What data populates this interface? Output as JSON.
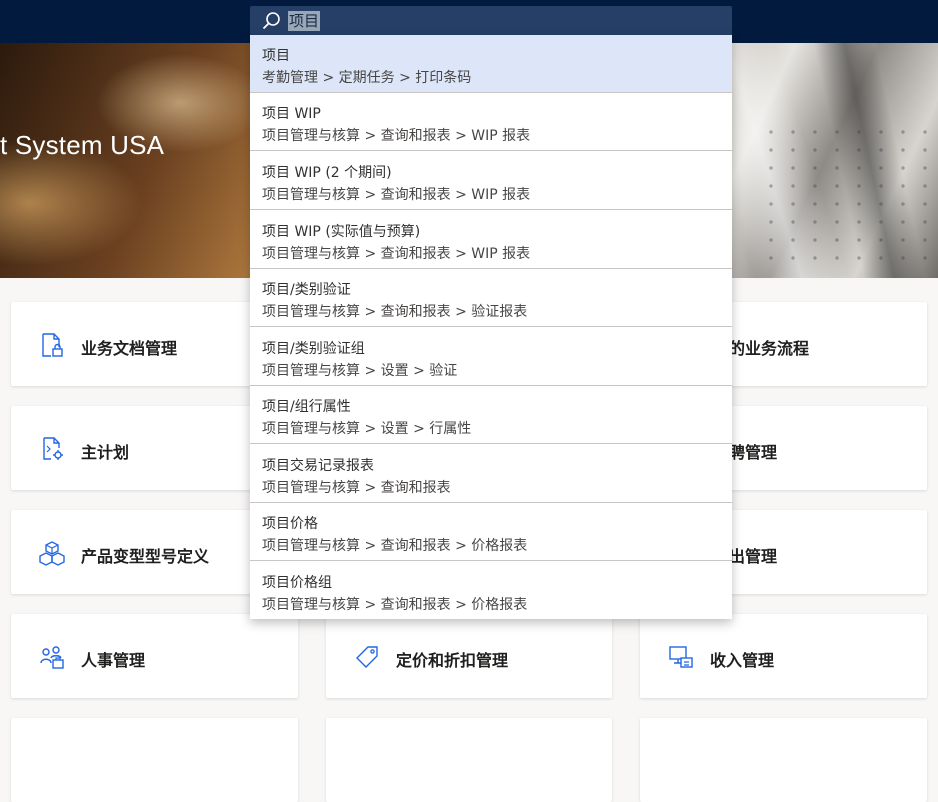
{
  "header": {
    "search": {
      "value": "项目",
      "placeholder": ""
    }
  },
  "hero": {
    "title": "t System USA"
  },
  "suggestions": [
    {
      "title": "项目",
      "path": "考勤管理 > 定期任务 > 打印条码"
    },
    {
      "title": "项目 WIP",
      "path": "项目管理与核算 > 查询和报表 > WIP 报表"
    },
    {
      "title": "项目 WIP (2 个期间)",
      "path": "项目管理与核算 > 查询和报表 > WIP 报表"
    },
    {
      "title": "项目 WIP (实际值与预算)",
      "path": "项目管理与核算 > 查询和报表 > WIP 报表"
    },
    {
      "title": "项目/类别验证",
      "path": "项目管理与核算 > 查询和报表 > 验证报表"
    },
    {
      "title": "项目/类别验证组",
      "path": "项目管理与核算 > 设置 > 验证"
    },
    {
      "title": "项目/组行属性",
      "path": "项目管理与核算 > 设置 > 行属性"
    },
    {
      "title": "项目交易记录报表",
      "path": "项目管理与核算 > 查询和报表"
    },
    {
      "title": "项目价格",
      "path": "项目管理与核算 > 查询和报表 > 价格报表"
    },
    {
      "title": "项目价格组",
      "path": "项目管理与核算 > 查询和报表 > 价格报表"
    }
  ],
  "tiles": {
    "left": [
      {
        "label": "业务文档管理",
        "icon": "document-lock-icon"
      },
      {
        "label": "主计划",
        "icon": "document-gear-icon"
      },
      {
        "label": "产品变型型号定义",
        "icon": "cubes-icon"
      },
      {
        "label": "人事管理",
        "icon": "people-icon"
      }
    ],
    "middle": [
      {
        "label": "定价和折扣管理",
        "icon": "tag-icon"
      }
    ],
    "right": [
      {
        "label": "的业务流程"
      },
      {
        "label": "聘管理"
      },
      {
        "label": "出管理"
      },
      {
        "label": "收入管理",
        "icon": "revenue-icon"
      }
    ]
  },
  "colors": {
    "topbar": "#021a3d",
    "search_bg": "#263f66",
    "selected_row": "#dce6f8",
    "icon_blue": "#2266e3"
  }
}
